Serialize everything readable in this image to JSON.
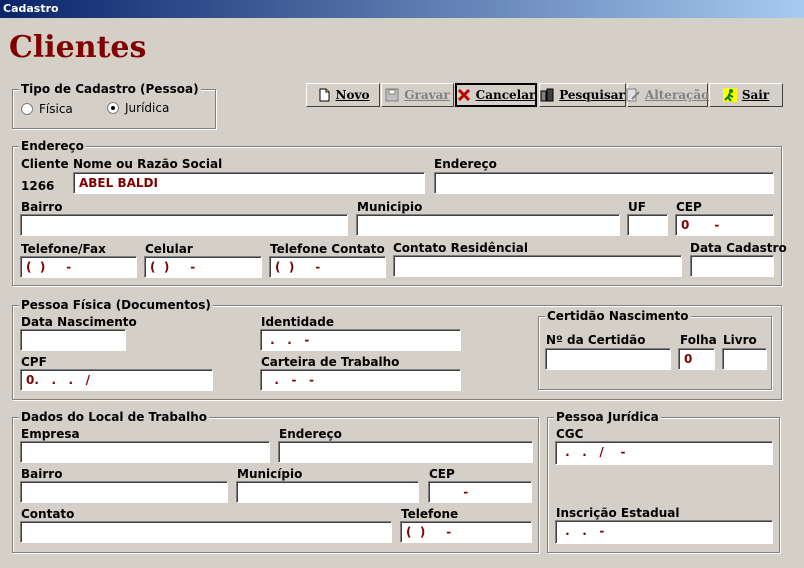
{
  "window": {
    "title": "Cadastro"
  },
  "page": {
    "title": "Clientes"
  },
  "tipo": {
    "legend": "Tipo de Cadastro  (Pessoa)",
    "fisica": "Física",
    "juridica": "Jurídica",
    "selected": "juridica"
  },
  "toolbar": {
    "novo": "Novo",
    "gravar": "Gravar",
    "cancelar": "Cancelar",
    "pesquisar": "Pesquisar",
    "alteracao": "Alteração",
    "sair": "Sair"
  },
  "endereco": {
    "legend": "Endereço",
    "cliente_label": "Cliente",
    "cliente_value": "1266",
    "nome_label": "Nome ou Razão Social",
    "nome_value": "ABEL BALDI",
    "endereco_label": "Endereço",
    "endereco_value": "",
    "bairro_label": "Bairro",
    "bairro_value": "",
    "municipio_label": "Municipio",
    "municipio_value": "",
    "uf_label": "UF",
    "uf_value": "",
    "cep_label": "CEP",
    "cep_value": "0      -",
    "telefone_label": "Telefone/Fax",
    "telefone_value": "(  )     -",
    "celular_label": "Celular",
    "celular_value": "(  )     -",
    "contato_tel_label": "Telefone Contato",
    "contato_tel_value": "(  )     -",
    "contato_res_label": "Contato Residêncial",
    "contato_res_value": "",
    "data_cad_label": "Data Cadastro",
    "data_cad_value": ""
  },
  "pessoa_fisica": {
    "legend": "Pessoa Física (Documentos)",
    "nascimento_label": "Data Nascimento",
    "nascimento_value": "",
    "identidade_label": "Identidade",
    "identidade_value": " .   .   -",
    "cpf_label": "CPF",
    "cpf_value": "0.   .   .   /",
    "carteira_label": "Carteira de Trabalho",
    "carteira_value": "  .   -   -"
  },
  "certidao": {
    "legend": "Certidão Nascimento",
    "numero_label": "Nº da Certidão",
    "numero_value": "",
    "folha_label": "Folha",
    "folha_value": "0",
    "livro_label": "Livro",
    "livro_value": ""
  },
  "trabalho": {
    "legend": "Dados do Local de Trabalho",
    "empresa_label": "Empresa",
    "empresa_value": "",
    "endereco_label": "Endereço",
    "endereco_value": "",
    "bairro_label": "Bairro",
    "bairro_value": "",
    "municipio_label": "Município",
    "municipio_value": "",
    "cep_label": "CEP",
    "cep_value": "       -",
    "contato_label": "Contato",
    "contato_value": "",
    "telefone_label": "Telefone",
    "telefone_value": "(  )     -"
  },
  "juridica": {
    "legend": "Pessoa Jurídica",
    "cgc_label": "CGC",
    "cgc_value": " .   .   /    -",
    "inscricao_label": "Inscrição Estadual",
    "inscricao_value": " .   .   -"
  }
}
